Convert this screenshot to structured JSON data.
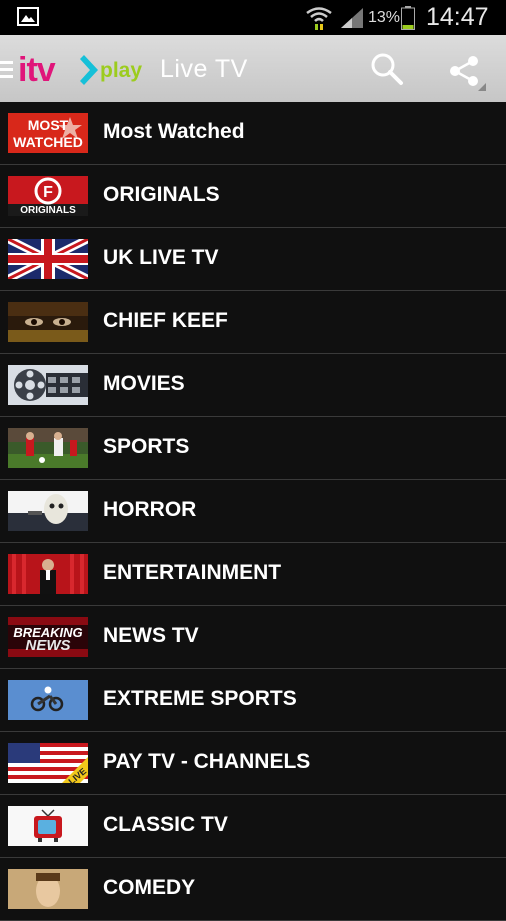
{
  "status_bar": {
    "battery_percent": "13%",
    "time": "14:47",
    "icons": [
      "gallery-icon",
      "wifi-icon",
      "signal-icon",
      "battery-icon"
    ]
  },
  "action_bar": {
    "logo_text_itv": "itv",
    "logo_text_play": "play",
    "title": "Live TV",
    "icons": [
      "menu-icon",
      "search-icon",
      "share-icon"
    ]
  },
  "categories": [
    {
      "label": "Most Watched",
      "thumb_text": "MOST WATCHED"
    },
    {
      "label": "ORIGINALS",
      "thumb_text": "ORIGINALS"
    },
    {
      "label": "UK LIVE TV"
    },
    {
      "label": "CHIEF KEEF"
    },
    {
      "label": "MOVIES"
    },
    {
      "label": "SPORTS"
    },
    {
      "label": "HORROR"
    },
    {
      "label": "ENTERTAINMENT"
    },
    {
      "label": "NEWS TV",
      "thumb_text": "BREAKING NEWS"
    },
    {
      "label": "EXTREME SPORTS"
    },
    {
      "label": "PAY TV - CHANNELS",
      "thumb_text": "LIVE"
    },
    {
      "label": "CLASSIC TV"
    },
    {
      "label": "COMEDY"
    }
  ],
  "colors": {
    "status_bar": "#000000",
    "action_bar": "#d0d0d0",
    "list_background": "#101010",
    "logo_pink": "#e0157a",
    "logo_cyan": "#16c0d8",
    "logo_green": "#9ccc1e"
  }
}
